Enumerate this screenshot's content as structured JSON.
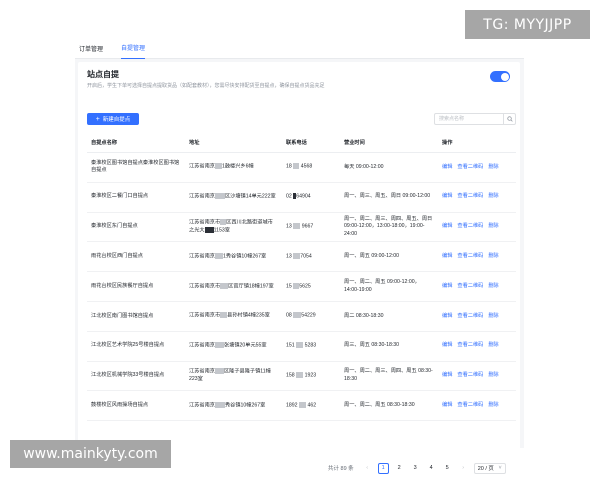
{
  "watermarks": {
    "top": "TG: MYYJJPP",
    "bottom": "www.mainkyty.com"
  },
  "tabs": [
    {
      "label": "订单管理",
      "active": false
    },
    {
      "label": "自提管理",
      "active": true
    }
  ],
  "section": {
    "title": "站点自提",
    "description": "开启后，学生下单可选择自提点提取货品（如配套教材），您需尽快安排配货至自提点，确保自提点货品充足",
    "toggle_on": true
  },
  "toolbar": {
    "add_label": "新建自提点",
    "search_placeholder": "搜索点名称"
  },
  "table": {
    "headers": [
      "自提点名称",
      "地址",
      "联系电话",
      "营业时间",
      "操作"
    ],
    "rows": [
      {
        "name": "秦淮校区图书馆自提点秦淮校区图书馆自提点",
        "address": [
          "江苏省南京",
          "1鼓楼兴乡6幢"
        ],
        "phone": [
          "18",
          "4568"
        ],
        "hours": "每天 09:00-12:00"
      },
      {
        "name": "秦淮校区二餐门口自提点",
        "address": [
          "江苏省南京",
          "区沙塘镇14单元222室"
        ],
        "phone": [
          "02",
          "64904"
        ],
        "hours": "周一、周三、周五、周日 09:00-12:00"
      },
      {
        "name": "秦淮校区东门自提点",
        "address": [
          "江苏省南京市",
          "区西川北路街道城市之光大",
          "1153室"
        ],
        "phone": [
          "13",
          "9667"
        ],
        "hours": "周一、周二、周三、周四、周五、周日 09:00-12:00，13:00-18:00，19:00-24:00"
      },
      {
        "name": "雨花台校区西门自提点",
        "address": [
          "江苏省南京",
          "1秀谷镇10幢267室"
        ],
        "phone": [
          "13",
          "7054"
        ],
        "hours": "周一、周五 09:00-12:00"
      },
      {
        "name": "雨花台校区民族餐厅自提点",
        "address": [
          "江苏省南京市",
          "区官厅镇18幢197室"
        ],
        "phone": [
          "15",
          "5625"
        ],
        "hours": "周一、周二、周五 09:00-12:00，14:00-19:00"
      },
      {
        "name": "江北校区南门图书馆自提点",
        "address": [
          "江苏省南京市",
          "县孙村镇4幢235室"
        ],
        "phone": [
          "08",
          "54229"
        ],
        "hours": "周二 08:30-18:30"
      },
      {
        "name": "江北校区艺术学院25号楼自提点",
        "address": [
          "江苏省南京",
          "张塘镇20单元55室"
        ],
        "phone": [
          "151",
          "5283"
        ],
        "hours": "周三、周五 08:30-18:30"
      },
      {
        "name": "江北校区机械学院33号楼自提点",
        "address": [
          "江苏省南京",
          "区隆子县隆子镇11幢223室"
        ],
        "phone": [
          "158",
          "1923"
        ],
        "hours": "周一、周二、周三、周四、周五 08:30-18:30"
      },
      {
        "name": "鼓楼校区风雨操场自提点",
        "address": [
          "江苏省南京",
          "秀谷镇10幢267室"
        ],
        "phone": [
          "1892",
          "462"
        ],
        "hours": "周一、周二、周五 08:30-18:30"
      }
    ],
    "actions": [
      "编辑",
      "查看二维码",
      "删除"
    ]
  },
  "pagination": {
    "total_text": "共计 89 条",
    "pages": [
      "1",
      "2",
      "3",
      "4",
      "5"
    ],
    "current": "1",
    "page_size": "20 / 页"
  },
  "colors": {
    "accent": "#3370ff",
    "background": "#f5f6f8",
    "text": "#1f2329",
    "muted": "#8f959e"
  }
}
